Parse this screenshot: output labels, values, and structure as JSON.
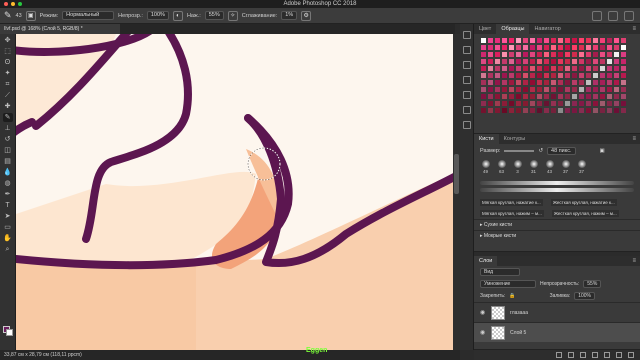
{
  "window": {
    "title": "Adobe Photoshop CC 2018",
    "traffic": [
      "#ff5f57",
      "#febc2e",
      "#28c840"
    ]
  },
  "options": {
    "size": "43",
    "mode_label": "Режим:",
    "mode_value": "Нормальный",
    "opacity_label": "Непрозр.:",
    "opacity_value": "100%",
    "flow_label": "Наж.:",
    "flow_value": "55%",
    "smoothing_label": "Сглаживание:",
    "smoothing_value": "1%"
  },
  "document": {
    "tab": "Ilvf.psd @ 168% (Слой 5, RGB/8) *"
  },
  "toolbar": {
    "tools": [
      "move-icon",
      "marquee-icon",
      "lasso-icon",
      "magic-wand-icon",
      "crop-icon",
      "eyedropper-icon",
      "healing-icon",
      "brush-icon",
      "stamp-icon",
      "history-brush-icon",
      "eraser-icon",
      "gradient-icon",
      "blur-icon",
      "dodge-icon",
      "pen-icon",
      "type-icon",
      "path-select-icon",
      "shape-icon",
      "hand-icon",
      "zoom-icon"
    ],
    "active": "brush-icon",
    "fg_color": "#6b1e5e",
    "bg_color": "#ffffff"
  },
  "status": {
    "info": "33,87 см x 28,79 см (118,11 ppcm)",
    "green_text": "Eggen"
  },
  "swatches_panel": {
    "tabs": [
      "Цвет",
      "Образцы",
      "Навигатор"
    ],
    "active_tab": "Образцы",
    "colors": [
      "#e8e8e8",
      "#d23a7d",
      "#c9266b",
      "#e04a86",
      "#d11d5a",
      "#f08aa6",
      "#c73a6c",
      "#e06494",
      "#b3185a",
      "#d8427a",
      "#c01e4c",
      "#f05a78",
      "#d42a55",
      "#b00f3e",
      "#e8385e",
      "#c8294a",
      "#f26a8b",
      "#d53868",
      "#9e1b4a",
      "#e0497d",
      "#c23662"
    ]
  },
  "brushes_panel": {
    "tabs": [
      "Кисти",
      "Контуры"
    ],
    "active_tab": "Кисти",
    "size_label": "Размер:",
    "size_value": "48 пикс.",
    "tips": [
      "49",
      "63",
      "3",
      "31",
      "43",
      "37",
      "37"
    ],
    "brush_names": [
      "Мягкая круглая, нажатие к...",
      "Жесткая круглая, нажатие к...",
      "Мягкая круглая, нажим – м...",
      "Жесткая круглая, нажим – м..."
    ],
    "groups": [
      "Сухие кисти",
      "Мокрые кисти"
    ]
  },
  "layers_panel": {
    "tabs": [
      "Слои"
    ],
    "filter_label": "Вид",
    "blend_mode": "Умножение",
    "opacity_label": "Непрозрачность:",
    "opacity_value": "55%",
    "lock_label": "Закрепить:",
    "fill_label": "Заливка:",
    "fill_value": "100%",
    "layers": [
      {
        "name": "глазааа",
        "selected": false
      },
      {
        "name": "Слой 5",
        "selected": true
      }
    ]
  },
  "canvas": {
    "outline_color": "#5c1650",
    "skin_light": "#fde6d0",
    "skin_mid": "#f8c9a4",
    "skin_dark": "#f2a47a",
    "background": "#fdf6ee"
  }
}
